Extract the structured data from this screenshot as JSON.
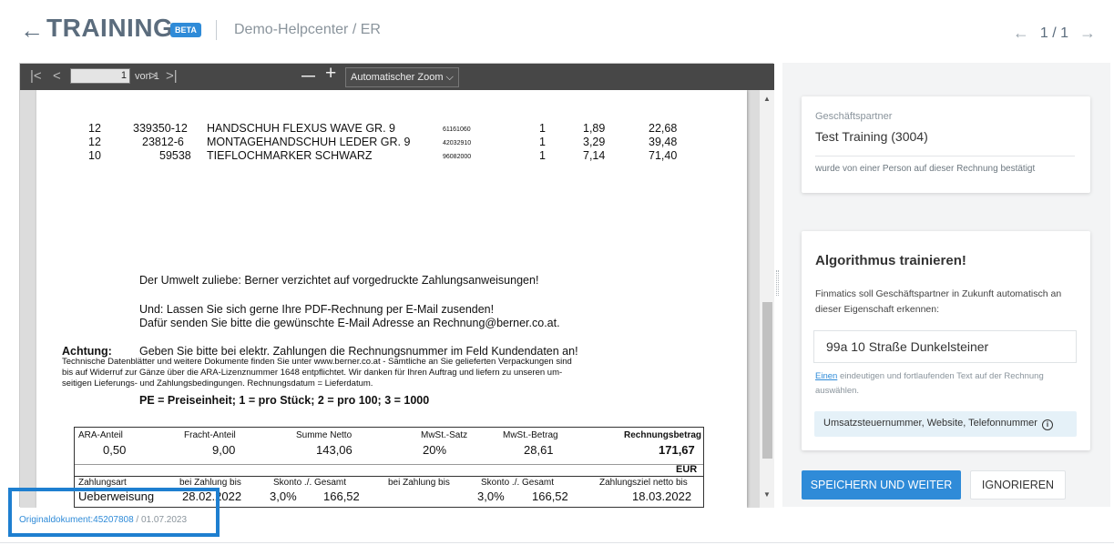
{
  "header": {
    "back_icon": "arrow-left-icon",
    "title": "TRAINING",
    "badge": "BETA",
    "breadcrumb": "Demo-Helpcenter / ER",
    "pager": {
      "prev_icon": "arrow-left-icon",
      "text": "1 / 1",
      "next_icon": "arrow-right-icon"
    }
  },
  "viewer": {
    "toolbar": {
      "first": "|<",
      "prev": "<",
      "page": "1",
      "of": "von 1",
      "next": ">",
      "last": ">|",
      "zoom_out": "—",
      "zoom_in": "+",
      "zoom": "Automatischer Zoom ⌵"
    },
    "document": {
      "line_items": [
        {
          "qty": "12",
          "article": "339350-12",
          "desc": "HANDSCHUH FLEXUS WAVE GR. 9",
          "code": "61161060",
          "unit": "1",
          "price": "1,89",
          "total": "22,68"
        },
        {
          "qty": "12",
          "article": "23812-6",
          "desc": "MONTAGEHANDSCHUH LEDER GR. 9",
          "code": "42032910",
          "unit": "1",
          "price": "3,29",
          "total": "39,48"
        },
        {
          "qty": "10",
          "article": "59538",
          "desc": "TIEFLOCHMARKER SCHWARZ",
          "code": "96082000",
          "unit": "1",
          "price": "7,14",
          "total": "71,40"
        }
      ],
      "umwelt": "Der Umwelt zuliebe: Berner verzichtet auf vorgedruckte Zahlungsanweisungen!",
      "und": "Und: Lassen Sie sich gerne Ihre PDF-Rechnung per E-Mail zusenden!",
      "dafuer": "Dafür senden Sie bitte die gewünschte E-Mail Adresse an Rechnung@berner.co.at.",
      "achtung_label": "Achtung:",
      "achtung_text": "Geben Sie bitte bei elektr. Zahlungen   die Rechnungsnummer im Feld Kundendaten an!",
      "small1": "Technische Datenblätter und weitere Dokumente finden Sie unter www.berner.co.at - Sämtliche an Sie gelieferten Verpackungen sind",
      "small2": "bis auf Widerruf zur Gänze über die ARA-Lizenznummer 1648 entpflichtet. Wir danken für Ihren Auftrag und liefern zu unseren um-",
      "small3": "seitigen Lieferungs- und Zahlungsbedingungen. Rechnungsdatum = Lieferdatum.",
      "pe": "PE =  Preiseinheit; 1 =  pro Stück; 2 =  pro 100; 3 =  1000",
      "totals": {
        "h_ara": "ARA-Anteil",
        "h_fracht": "Fracht-Anteil",
        "h_netto": "Summe Netto",
        "h_mwst_satz": "MwSt.-Satz",
        "h_mwst_betrag": "MwSt.-Betrag",
        "h_rechnung": "Rechnungsbetrag",
        "v_ara": "0,50",
        "v_fracht": "9,00",
        "v_netto": "143,06",
        "v_mwst_satz": "20%",
        "v_mwst_betrag": "28,61",
        "v_rechnung": "171,67",
        "currency": "EUR",
        "h_zahlungsart": "Zahlungsart",
        "h_bei1": "bei Zahlung bis",
        "h_skonto1": "Skonto  ./.  Gesamt",
        "h_bei2": "bei Zahlung bis",
        "h_skonto2": "Skonto  ./.  Gesamt",
        "h_ziel": "Zahlungsziel netto bis",
        "v_zahlungsart": "Ueberweisung",
        "v_bei1": "28.02.2022",
        "v_skonto1": "3,0%",
        "v_gesamt1": "166,52",
        "v_skonto2": "3,0%",
        "v_gesamt2": "166,52",
        "v_ziel": "18.03.2022"
      }
    }
  },
  "original": {
    "label": "Originaldokument:",
    "id": "45207808",
    "date": " / 01.07.2023"
  },
  "panel": {
    "partner": {
      "label": "Geschäftspartner",
      "value": "Test Training (3004)",
      "note": "wurde von einer Person auf dieser Rechnung bestätigt"
    },
    "train": {
      "heading": "Algorithmus trainieren!",
      "desc": "Finmatics soll Geschäftspartner in Zukunft automatisch an dieser Eigenschaft erkennen:",
      "field_value": "99a 10 Straße Dunkelsteiner",
      "hint_link": "Einen",
      "hint_rest": " eindeutigen und fortlaufenden Text auf der Rechnung auswählen.",
      "chip": "Umsatzsteuernummer, Website, Telefonnummer",
      "chip_icon": "info-icon"
    },
    "save_label": "SPEICHERN UND WEITER",
    "ignore_label": "IGNORIEREN"
  },
  "colors": {
    "accent": "#2f8bd8",
    "highlight_border": "#1e7fd0",
    "toolbar": "#474747"
  }
}
